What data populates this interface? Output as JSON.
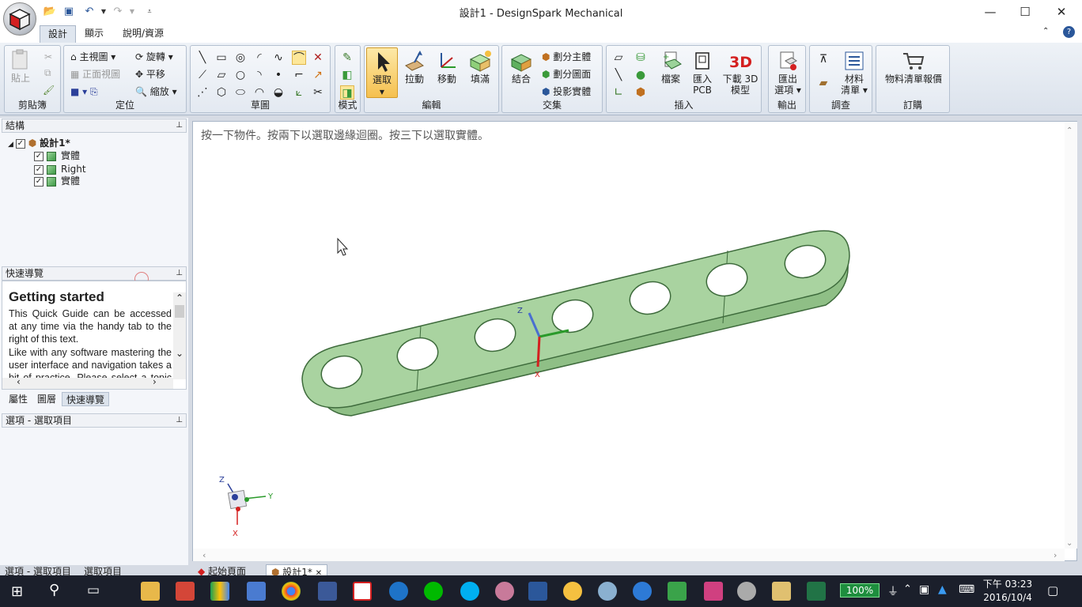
{
  "window": {
    "title": "設計1 - DesignSpark Mechanical"
  },
  "tabs": [
    {
      "label": "設計"
    },
    {
      "label": "顯示"
    },
    {
      "label": "說明/資源"
    }
  ],
  "ribbon": {
    "clipboard": {
      "paste": "貼上",
      "label": "剪貼簿"
    },
    "orient": {
      "home": "主視圖",
      "spin": "旋轉",
      "plan": "正面視圖",
      "pan": "平移",
      "zoom": "縮放",
      "label": "定位"
    },
    "sketch": {
      "label": "草圖"
    },
    "mode": {
      "label": "模式"
    },
    "edit": {
      "select": "選取",
      "pull": "拉動",
      "move": "移動",
      "fill": "填滿",
      "label": "編輯"
    },
    "intersect": {
      "combine": "結合",
      "split_body": "劃分主體",
      "split_face": "劃分圖面",
      "project": "投影實體",
      "label": "交集"
    },
    "insert": {
      "file": "檔案",
      "pcb1": "匯入",
      "pcb2": "PCB",
      "dl1": "下載 3D",
      "dl2": "模型",
      "label": "插入"
    },
    "output": {
      "export1": "匯出",
      "export2": "選項",
      "label": "輸出"
    },
    "investigate": {
      "bom1": "材料",
      "bom2": "清單",
      "label": "調查"
    },
    "order": {
      "quote": "物料清單報價",
      "label": "訂購"
    }
  },
  "structure": {
    "title": "結構",
    "root": "設計1*",
    "items": [
      {
        "label": "實體"
      },
      {
        "label": "Right"
      },
      {
        "label": "實體"
      }
    ]
  },
  "quick_guide": {
    "title": "快速導覽",
    "heading": "Getting started",
    "p1": "This Quick Guide can be accessed at any time via the handy tab to the right of this text.",
    "p2": "Like with any software mastering the user interface and navigation takes a bit of practice. Please select a topic of"
  },
  "panel_tabs": [
    {
      "label": "屬性"
    },
    {
      "label": "圖層"
    },
    {
      "label": "快速導覽"
    }
  ],
  "options": {
    "title": "選項 - 選取項目"
  },
  "bottom_left_tabs": [
    {
      "label": "選項 - 選取項目"
    },
    {
      "label": "選取項目"
    }
  ],
  "viewport": {
    "hint": "按一下物件。按兩下以選取邊緣迴圈。按三下以選取實體。"
  },
  "axes": {
    "z": "Z",
    "y": "Y",
    "x": "X"
  },
  "doc_tabs": [
    {
      "label": "起始頁面"
    },
    {
      "label": "設計1*"
    }
  ],
  "taskbar": {
    "zoom": "100%",
    "time": "下午 03:23",
    "date": "2016/10/4"
  },
  "colors": {
    "part": "#a9d3a0",
    "part_edge": "#3e6b3c",
    "accent": "#2b579a"
  }
}
